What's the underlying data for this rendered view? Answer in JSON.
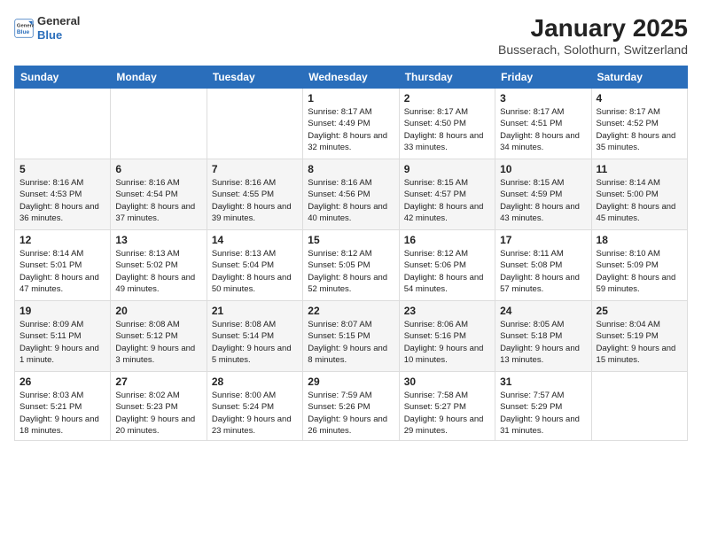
{
  "header": {
    "logo_general": "General",
    "logo_blue": "Blue",
    "main_title": "January 2025",
    "subtitle": "Busserach, Solothurn, Switzerland"
  },
  "days_of_week": [
    "Sunday",
    "Monday",
    "Tuesday",
    "Wednesday",
    "Thursday",
    "Friday",
    "Saturday"
  ],
  "weeks": [
    [
      {
        "day": "",
        "info": ""
      },
      {
        "day": "",
        "info": ""
      },
      {
        "day": "",
        "info": ""
      },
      {
        "day": "1",
        "info": "Sunrise: 8:17 AM\nSunset: 4:49 PM\nDaylight: 8 hours and 32 minutes."
      },
      {
        "day": "2",
        "info": "Sunrise: 8:17 AM\nSunset: 4:50 PM\nDaylight: 8 hours and 33 minutes."
      },
      {
        "day": "3",
        "info": "Sunrise: 8:17 AM\nSunset: 4:51 PM\nDaylight: 8 hours and 34 minutes."
      },
      {
        "day": "4",
        "info": "Sunrise: 8:17 AM\nSunset: 4:52 PM\nDaylight: 8 hours and 35 minutes."
      }
    ],
    [
      {
        "day": "5",
        "info": "Sunrise: 8:16 AM\nSunset: 4:53 PM\nDaylight: 8 hours and 36 minutes."
      },
      {
        "day": "6",
        "info": "Sunrise: 8:16 AM\nSunset: 4:54 PM\nDaylight: 8 hours and 37 minutes."
      },
      {
        "day": "7",
        "info": "Sunrise: 8:16 AM\nSunset: 4:55 PM\nDaylight: 8 hours and 39 minutes."
      },
      {
        "day": "8",
        "info": "Sunrise: 8:16 AM\nSunset: 4:56 PM\nDaylight: 8 hours and 40 minutes."
      },
      {
        "day": "9",
        "info": "Sunrise: 8:15 AM\nSunset: 4:57 PM\nDaylight: 8 hours and 42 minutes."
      },
      {
        "day": "10",
        "info": "Sunrise: 8:15 AM\nSunset: 4:59 PM\nDaylight: 8 hours and 43 minutes."
      },
      {
        "day": "11",
        "info": "Sunrise: 8:14 AM\nSunset: 5:00 PM\nDaylight: 8 hours and 45 minutes."
      }
    ],
    [
      {
        "day": "12",
        "info": "Sunrise: 8:14 AM\nSunset: 5:01 PM\nDaylight: 8 hours and 47 minutes."
      },
      {
        "day": "13",
        "info": "Sunrise: 8:13 AM\nSunset: 5:02 PM\nDaylight: 8 hours and 49 minutes."
      },
      {
        "day": "14",
        "info": "Sunrise: 8:13 AM\nSunset: 5:04 PM\nDaylight: 8 hours and 50 minutes."
      },
      {
        "day": "15",
        "info": "Sunrise: 8:12 AM\nSunset: 5:05 PM\nDaylight: 8 hours and 52 minutes."
      },
      {
        "day": "16",
        "info": "Sunrise: 8:12 AM\nSunset: 5:06 PM\nDaylight: 8 hours and 54 minutes."
      },
      {
        "day": "17",
        "info": "Sunrise: 8:11 AM\nSunset: 5:08 PM\nDaylight: 8 hours and 57 minutes."
      },
      {
        "day": "18",
        "info": "Sunrise: 8:10 AM\nSunset: 5:09 PM\nDaylight: 8 hours and 59 minutes."
      }
    ],
    [
      {
        "day": "19",
        "info": "Sunrise: 8:09 AM\nSunset: 5:11 PM\nDaylight: 9 hours and 1 minute."
      },
      {
        "day": "20",
        "info": "Sunrise: 8:08 AM\nSunset: 5:12 PM\nDaylight: 9 hours and 3 minutes."
      },
      {
        "day": "21",
        "info": "Sunrise: 8:08 AM\nSunset: 5:14 PM\nDaylight: 9 hours and 5 minutes."
      },
      {
        "day": "22",
        "info": "Sunrise: 8:07 AM\nSunset: 5:15 PM\nDaylight: 9 hours and 8 minutes."
      },
      {
        "day": "23",
        "info": "Sunrise: 8:06 AM\nSunset: 5:16 PM\nDaylight: 9 hours and 10 minutes."
      },
      {
        "day": "24",
        "info": "Sunrise: 8:05 AM\nSunset: 5:18 PM\nDaylight: 9 hours and 13 minutes."
      },
      {
        "day": "25",
        "info": "Sunrise: 8:04 AM\nSunset: 5:19 PM\nDaylight: 9 hours and 15 minutes."
      }
    ],
    [
      {
        "day": "26",
        "info": "Sunrise: 8:03 AM\nSunset: 5:21 PM\nDaylight: 9 hours and 18 minutes."
      },
      {
        "day": "27",
        "info": "Sunrise: 8:02 AM\nSunset: 5:23 PM\nDaylight: 9 hours and 20 minutes."
      },
      {
        "day": "28",
        "info": "Sunrise: 8:00 AM\nSunset: 5:24 PM\nDaylight: 9 hours and 23 minutes."
      },
      {
        "day": "29",
        "info": "Sunrise: 7:59 AM\nSunset: 5:26 PM\nDaylight: 9 hours and 26 minutes."
      },
      {
        "day": "30",
        "info": "Sunrise: 7:58 AM\nSunset: 5:27 PM\nDaylight: 9 hours and 29 minutes."
      },
      {
        "day": "31",
        "info": "Sunrise: 7:57 AM\nSunset: 5:29 PM\nDaylight: 9 hours and 31 minutes."
      },
      {
        "day": "",
        "info": ""
      }
    ]
  ]
}
